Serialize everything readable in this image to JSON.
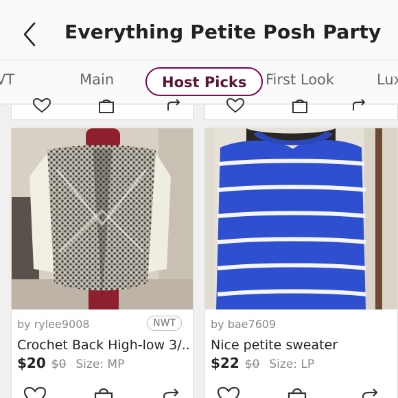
{
  "header": {
    "title": "Everything Petite Posh Party"
  },
  "tabs": [
    {
      "label": "VT"
    },
    {
      "label": "Main"
    },
    {
      "label": "Host Picks",
      "active": true
    },
    {
      "label": "First Look"
    },
    {
      "label": "Lux"
    }
  ],
  "listings": [
    {
      "seller": "by rylee9008",
      "badge": "NWT",
      "title": "Crochet Back High-low 3/...",
      "price": "$20",
      "original_price": "$0",
      "size": "Size: MP"
    },
    {
      "seller": "by bae7609",
      "badge": "",
      "title": "Nice petite sweater",
      "price": "$22",
      "original_price": "$0",
      "size": "Size: LP"
    }
  ],
  "icons": {
    "like": "heart-icon",
    "buy": "shopping-bag-icon",
    "share": "share-icon",
    "back": "chevron-left-icon"
  },
  "colors": {
    "accent": "#7f0353",
    "text": "#222222",
    "muted": "#888888",
    "sweater_blue": "#2d4fd0"
  }
}
